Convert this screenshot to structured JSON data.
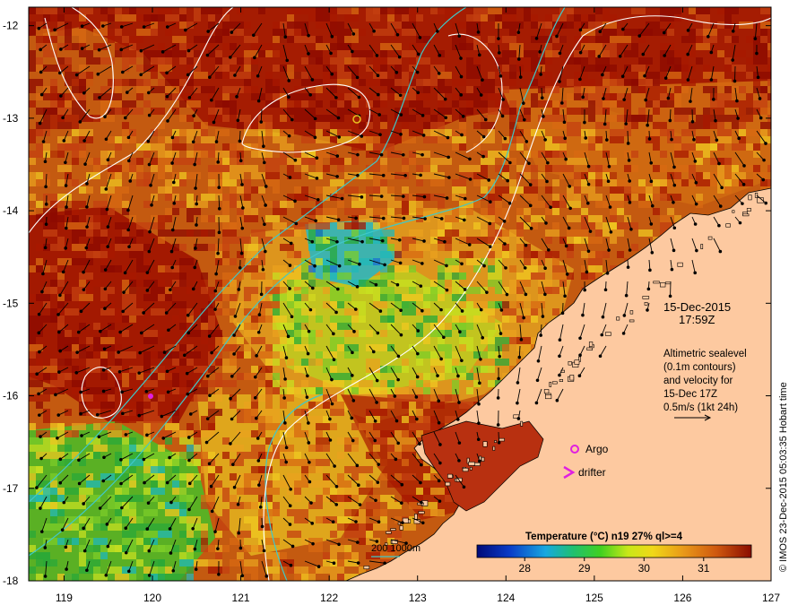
{
  "map": {
    "lat_ticks": [
      "-12",
      "-13",
      "-14",
      "-15",
      "-16",
      "-17",
      "-18"
    ],
    "lon_ticks": [
      "119",
      "120",
      "121",
      "122",
      "123",
      "124",
      "125",
      "126",
      "127"
    ],
    "lon_range": [
      118.6,
      127.0
    ],
    "lat_range": [
      -11.8,
      -18.0
    ]
  },
  "annotations": {
    "date": "15-Dec-2015",
    "time": "17:59Z",
    "altimetry_lines": [
      "Altimetric sealevel",
      "(0.1m contours)",
      "and velocity for",
      "15-Dec 17Z",
      "0.5m/s (1kt 24h)"
    ],
    "argo_label": "Argo",
    "drifter_label": "drifter",
    "bathy_label": "200  1000m",
    "credit": "© IMOS 23-Dec-2015 05:03:35 Hobart time"
  },
  "colorbar": {
    "title": "Temperature (°C) n19 27% ql>=4",
    "ticks": [
      "28",
      "29",
      "30",
      "31"
    ],
    "tick_values": [
      28,
      29,
      30,
      31
    ],
    "range": [
      27.2,
      31.8
    ]
  },
  "colors": {
    "land": "#fdc9a0",
    "hot": "#a01200",
    "warm": "#d86a12",
    "mid": "#e9a21e",
    "cool": "#a6d620",
    "cold": "#1e9a2e",
    "coldest": "#1ec8d8",
    "argo": "#e020e0",
    "bathy": "#40c8c8"
  }
}
